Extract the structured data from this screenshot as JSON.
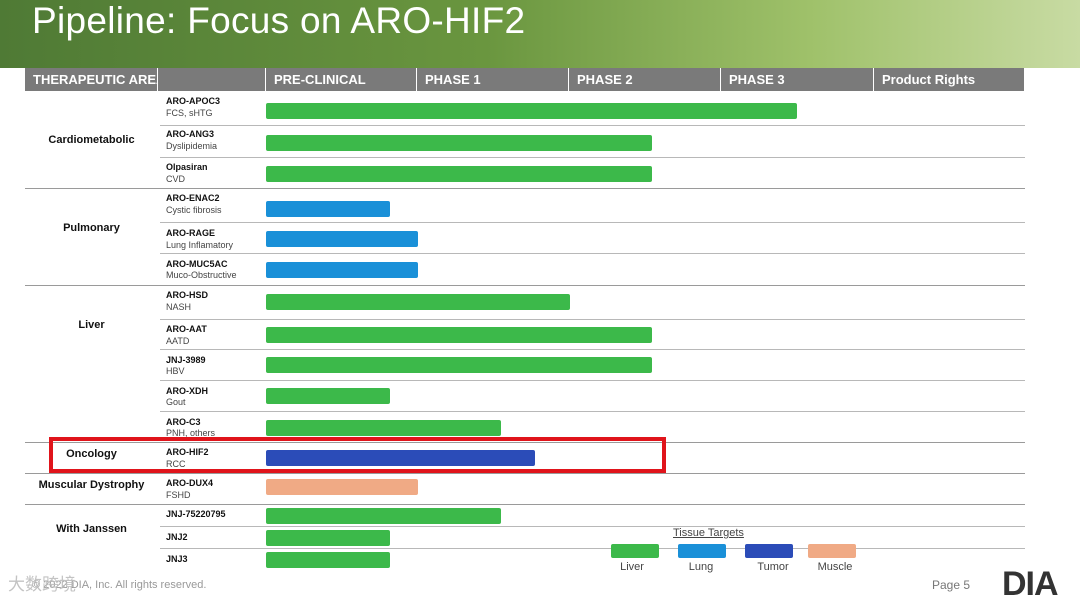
{
  "title": "Pipeline: Focus on ARO-HIF2",
  "headers": [
    "THERAPEUTIC AREA",
    "",
    "PRE-CLINICAL",
    "PHASE 1",
    "PHASE 2",
    "PHASE 3",
    "Product Rights"
  ],
  "areas": [
    {
      "name": "Cardiometabolic"
    },
    {
      "name": "Pulmonary"
    },
    {
      "name": "Liver"
    },
    {
      "name": "Oncology"
    },
    {
      "name": "Muscular Dystrophy"
    },
    {
      "name": "With Janssen"
    }
  ],
  "stage_colors": {
    "liver": "#3cb94a",
    "lung": "#1a90d8",
    "tumor": "#2b4cb8",
    "muscle": "#f0aa85"
  },
  "drugs": [
    {
      "name": "ARO-APOC3",
      "indication": "FCS, sHTG",
      "target": "liver",
      "progress": 0.77
    },
    {
      "name": "ARO-ANG3",
      "indication": "Dyslipidemia",
      "target": "liver",
      "progress": 0.56
    },
    {
      "name": "Olpasiran",
      "indication": "CVD",
      "target": "liver",
      "progress": 0.56
    },
    {
      "name": "ARO-ENAC2",
      "indication": "Cystic fibrosis",
      "target": "lung",
      "progress": 0.18
    },
    {
      "name": "ARO-RAGE",
      "indication": "Lung Inflamatory",
      "target": "lung",
      "progress": 0.22
    },
    {
      "name": "ARO-MUC5AC",
      "indication": "Muco-Obstructive",
      "target": "lung",
      "progress": 0.22
    },
    {
      "name": "ARO-HSD",
      "indication": "NASH",
      "target": "liver",
      "progress": 0.44
    },
    {
      "name": "ARO-AAT",
      "indication": "AATD",
      "target": "liver",
      "progress": 0.56
    },
    {
      "name": "JNJ-3989",
      "indication": "HBV",
      "target": "liver",
      "progress": 0.56
    },
    {
      "name": "ARO-XDH",
      "indication": "Gout",
      "target": "liver",
      "progress": 0.18
    },
    {
      "name": "ARO-C3",
      "indication": "PNH, others",
      "target": "liver",
      "progress": 0.34
    },
    {
      "name": "ARO-HIF2",
      "indication": "RCC",
      "target": "tumor",
      "progress": 0.39
    },
    {
      "name": "ARO-DUX4",
      "indication": "FSHD",
      "target": "muscle",
      "progress": 0.22
    },
    {
      "name": "JNJ-75220795",
      "indication": "",
      "target": "liver",
      "progress": 0.34
    },
    {
      "name": "JNJ2",
      "indication": "",
      "target": "liver",
      "progress": 0.18
    },
    {
      "name": "JNJ3",
      "indication": "",
      "target": "liver",
      "progress": 0.18
    }
  ],
  "legend": {
    "title": "Tissue Targets",
    "items": [
      {
        "label": "Liver",
        "color": "#3cb94a"
      },
      {
        "label": "Lung",
        "color": "#1a90d8"
      },
      {
        "label": "Tumor",
        "color": "#2b4cb8"
      },
      {
        "label": "Muscle",
        "color": "#f0aa85"
      }
    ]
  },
  "footer": {
    "copyright": "© 2022 DIA, Inc. All rights reserved.",
    "page": "Page 5",
    "logo": "DIA",
    "watermark": "大数跨境"
  }
}
